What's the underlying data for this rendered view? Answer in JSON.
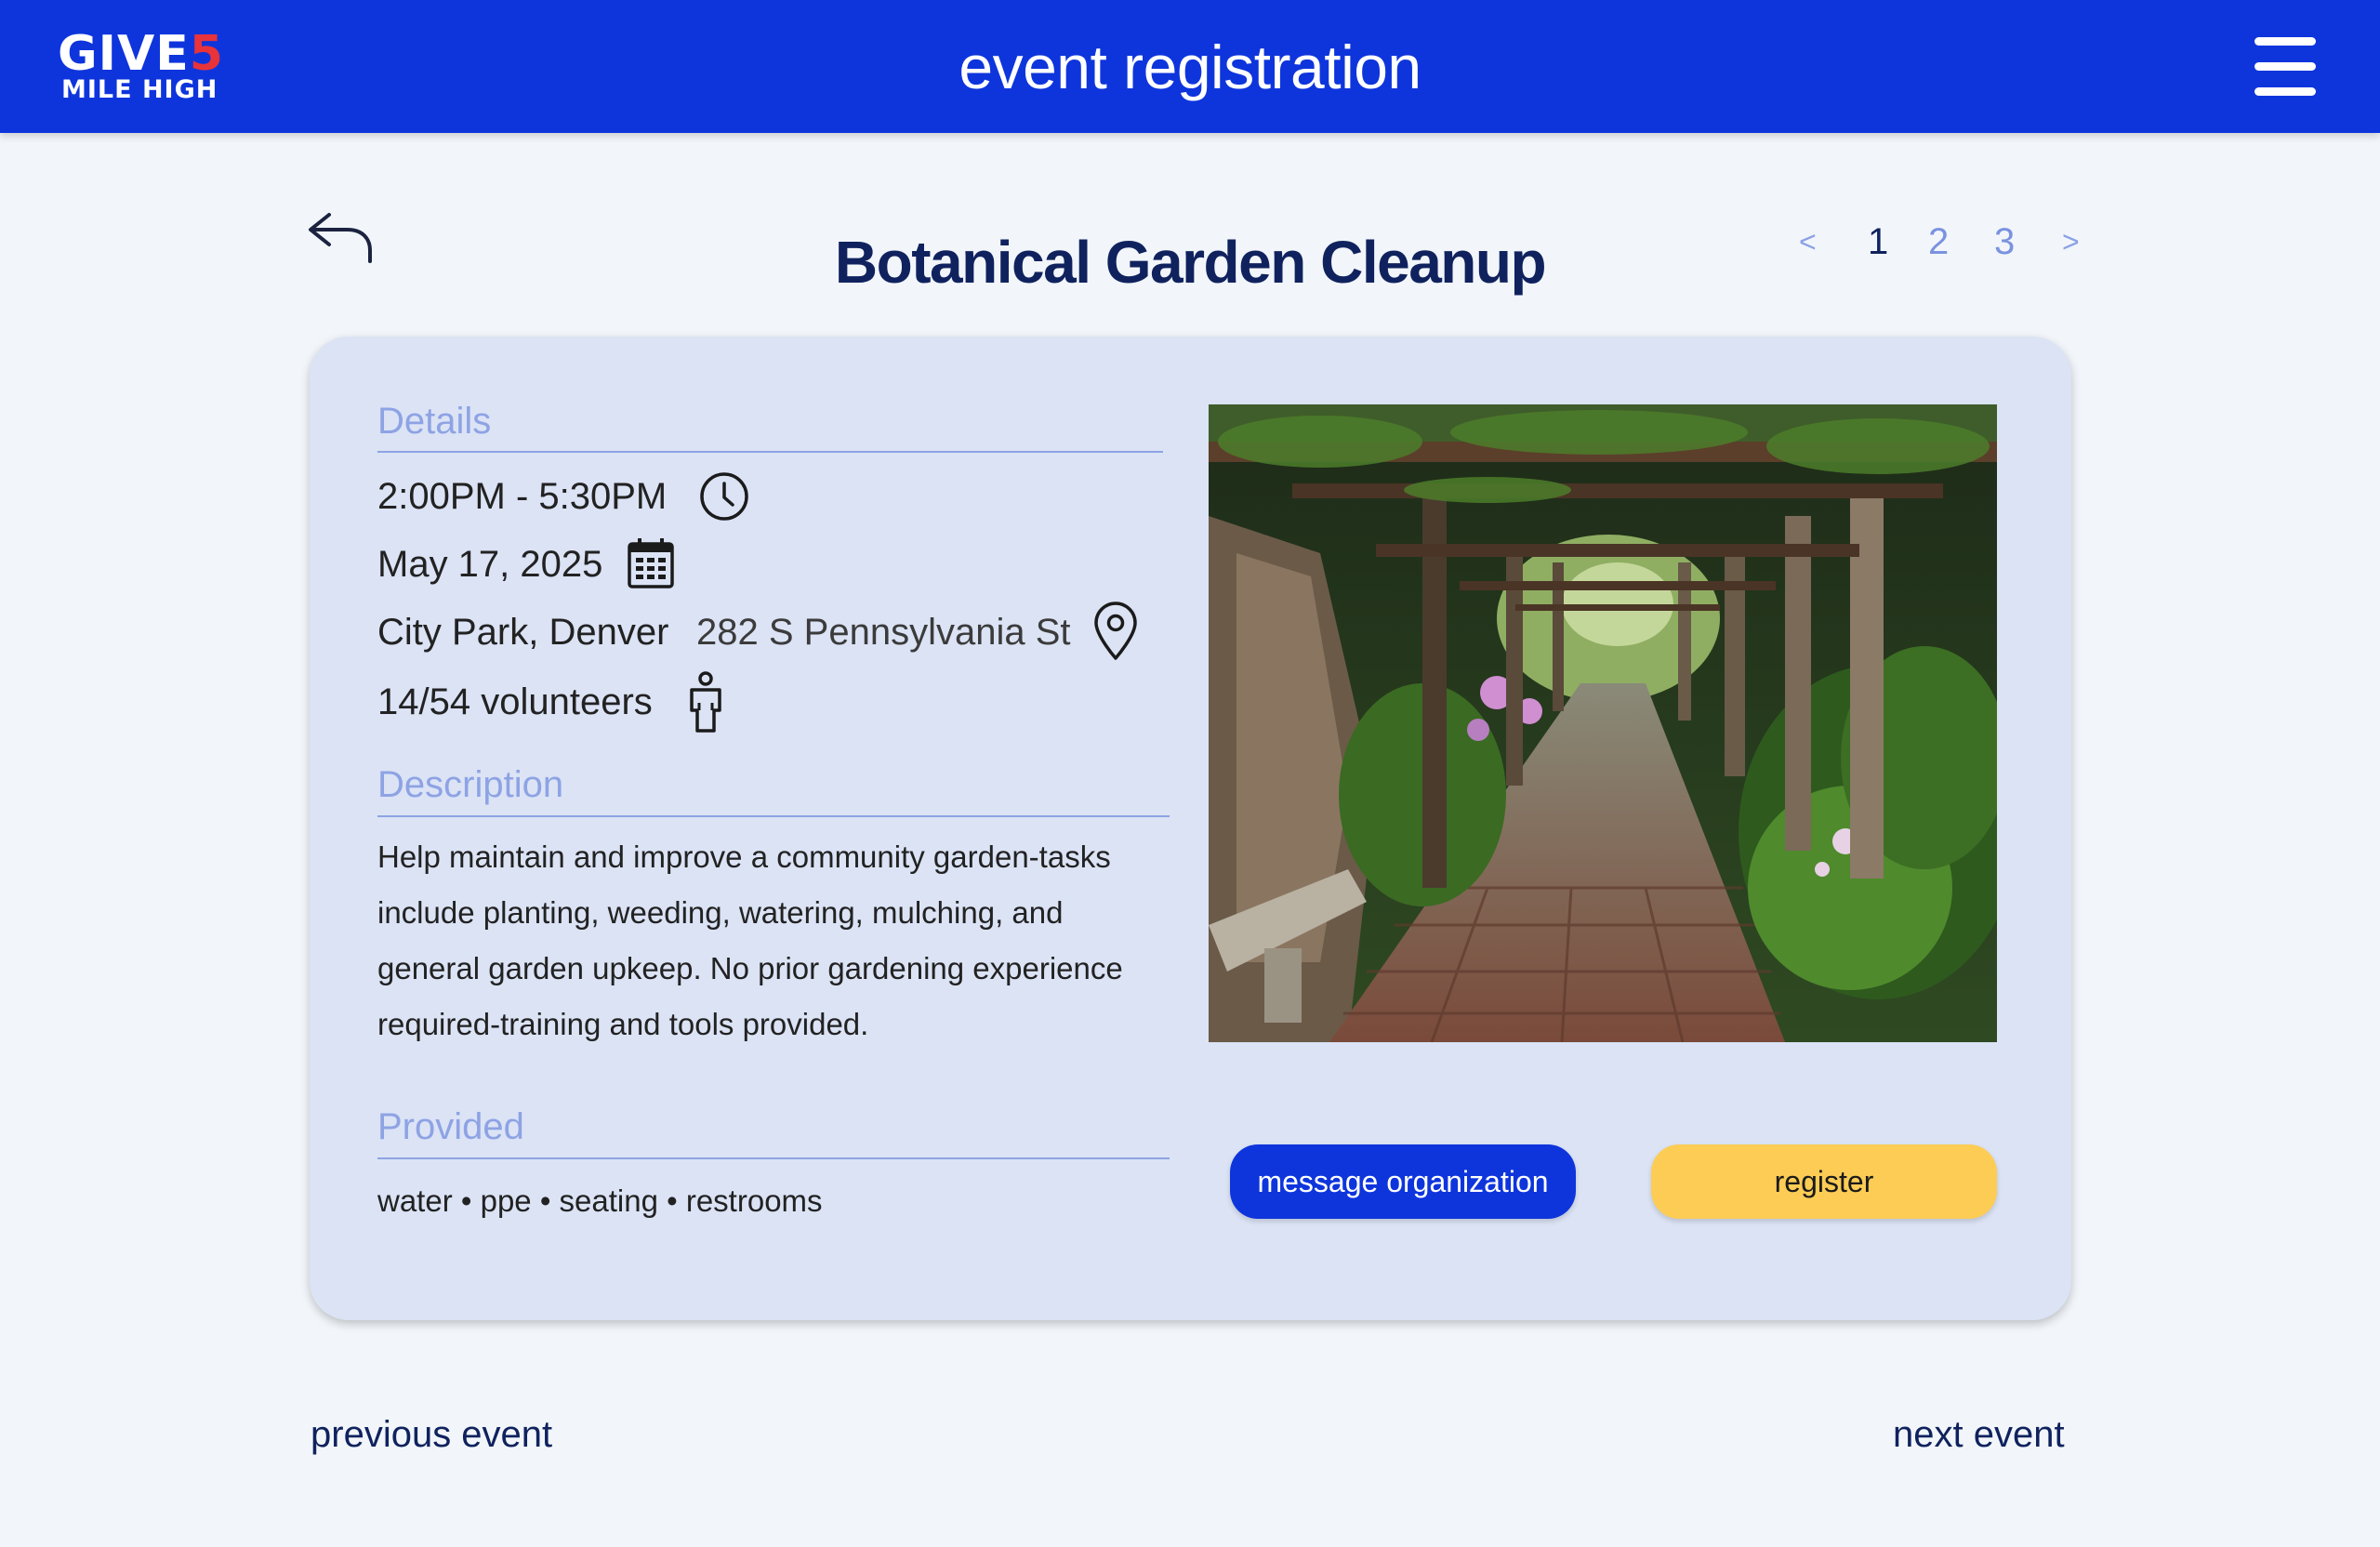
{
  "header": {
    "logo_top": "GIVE",
    "logo_number": "5",
    "logo_bottom": "MILE HIGH",
    "title": "event registration",
    "menu_icon": "hamburger-menu-icon"
  },
  "event": {
    "title": "Botanical Garden Cleanup",
    "pagination": {
      "prev": "<",
      "pages": [
        "1",
        "2",
        "3"
      ],
      "current": "1",
      "next": ">"
    },
    "details": {
      "label": "Details",
      "time": "2:00PM - 5:30PM",
      "date": "May 17, 2025",
      "location": "City Park, Denver",
      "address": "282 S Pennsylvania St",
      "volunteers": "14/54 volunteers"
    },
    "description": {
      "label": "Description",
      "text": "Help maintain and improve a community garden-tasks include planting, weeding, watering, mulching, and general garden upkeep. No prior gardening experience required-training and tools provided."
    },
    "provided": {
      "label": "Provided",
      "items": "water  •  ppe  •  seating  •  restrooms"
    },
    "actions": {
      "message": "message organization",
      "register": "register"
    }
  },
  "footer": {
    "previous": "previous event",
    "next": "next event"
  },
  "colors": {
    "brand_blue": "#0e35dc",
    "accent_red": "#e8333b",
    "register_yellow": "#fccc55",
    "card_bg": "#dbe3f5",
    "title_navy": "#10225e",
    "section_label": "#8ea3e4"
  },
  "icons": [
    "back-arrow-icon",
    "clock-icon",
    "calendar-icon",
    "map-pin-icon",
    "person-icon",
    "hamburger-menu-icon"
  ]
}
